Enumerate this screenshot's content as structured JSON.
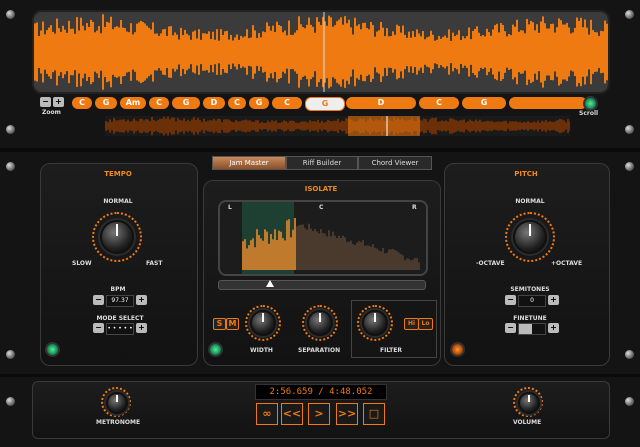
{
  "waveform": {
    "zoom_minus": "−",
    "zoom_plus": "+",
    "zoom_label": "Zoom",
    "scroll_label": "Scroll",
    "chords": [
      "C",
      "G",
      "Am",
      "C",
      "G",
      "D",
      "C",
      "G",
      "C",
      "G",
      "D",
      "C",
      "G",
      ""
    ],
    "selected_chord_index": 9
  },
  "tabs": [
    "Jam Master",
    "Riff Builder",
    "Chord Viewer"
  ],
  "active_tab": 0,
  "tempo": {
    "title": "TEMPO",
    "normal": "NORMAL",
    "slow": "SLOW",
    "fast": "FAST",
    "bpm_label": "BPM",
    "bpm_value": "97.37",
    "mode_label": "MODE SELECT",
    "mode_value": "• • • • •",
    "minus": "−",
    "plus": "+"
  },
  "isolate": {
    "title": "ISOLATE",
    "l": "L",
    "c": "C",
    "r": "R",
    "s": "S",
    "m": "M",
    "width": "WIDTH",
    "separation": "SEPARATION",
    "filter": "FILTER",
    "hi": "Hi",
    "lo": "Lo"
  },
  "pitch": {
    "title": "PITCH",
    "normal": "NORMAL",
    "minus_octave": "-OCTAVE",
    "plus_octave": "+OCTAVE",
    "semitones_label": "SEMITONES",
    "semitones_value": "0",
    "finetune_label": "FINETUNE",
    "minus": "−",
    "plus": "+"
  },
  "transport": {
    "time": "2:56.659 / 4:48.052",
    "loop": "∞",
    "rewind": "<<",
    "play": ">",
    "ffwd": ">>",
    "stop": "□",
    "metronome": "METRONOME",
    "volume": "VOLUME"
  },
  "colors": {
    "accent": "#ef7a11",
    "background": "#141414"
  }
}
